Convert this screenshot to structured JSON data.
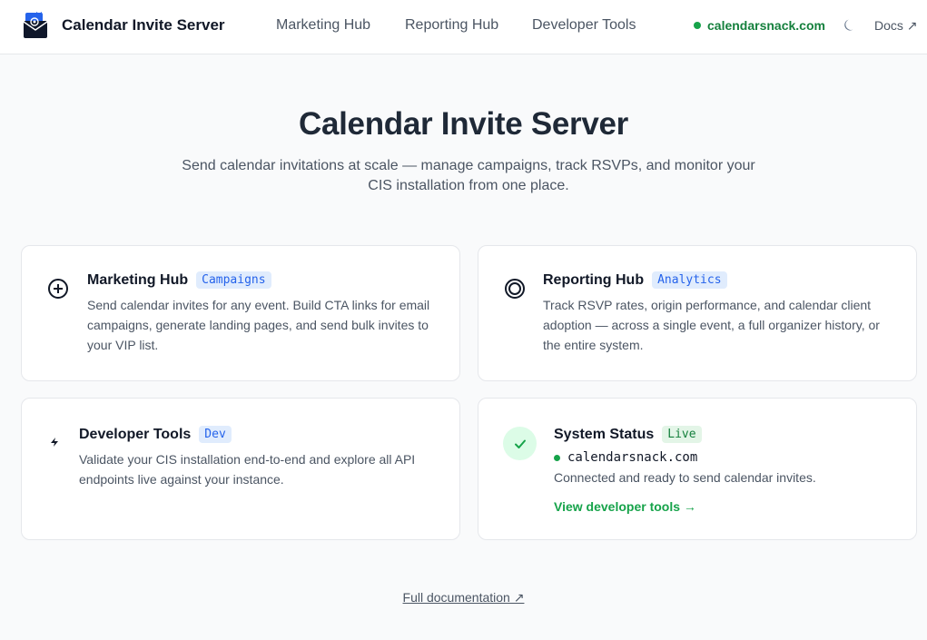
{
  "header": {
    "app_title": "Calendar Invite Server",
    "nav": [
      {
        "label": "Marketing Hub"
      },
      {
        "label": "Reporting Hub"
      },
      {
        "label": "Developer Tools"
      }
    ],
    "domain": "calendarsnack.com",
    "docs_label": "Docs ↗"
  },
  "hero": {
    "title": "Calendar Invite Server",
    "subtitle": "Send calendar invitations at scale — manage campaigns, track RSVPs, and monitor your CIS installation from one place."
  },
  "cards": {
    "marketing": {
      "title": "Marketing Hub",
      "tag": "Campaigns",
      "description": "Send calendar invites for any event. Build CTA links for email campaigns, generate landing pages, and send bulk invites to your VIP list."
    },
    "reporting": {
      "title": "Reporting Hub",
      "tag": "Analytics",
      "description": "Track RSVP rates, origin performance, and calendar client adoption — across a single event, a full organizer history, or the entire system."
    },
    "developer": {
      "title": "Developer Tools",
      "tag": "Dev",
      "description": "Validate your CIS installation end-to-end and explore all API endpoints live against your instance."
    },
    "status": {
      "title": "System Status",
      "tag": "Live",
      "domain": "calendarsnack.com",
      "text": "Connected and ready to send calendar invites.",
      "link_label": "View developer tools →"
    }
  },
  "footer": {
    "docs_label": "Full documentation ↗"
  },
  "icons": {
    "logo": "envelope-at-logo-icon",
    "theme": "moon-icon",
    "marketing": "plus-circle-icon",
    "reporting": "target-icon",
    "developer": "lightning-icon",
    "status": "check-icon"
  },
  "colors": {
    "accent_green": "#16a34a",
    "accent_blue": "#2563eb",
    "background": "#f9fafb"
  }
}
